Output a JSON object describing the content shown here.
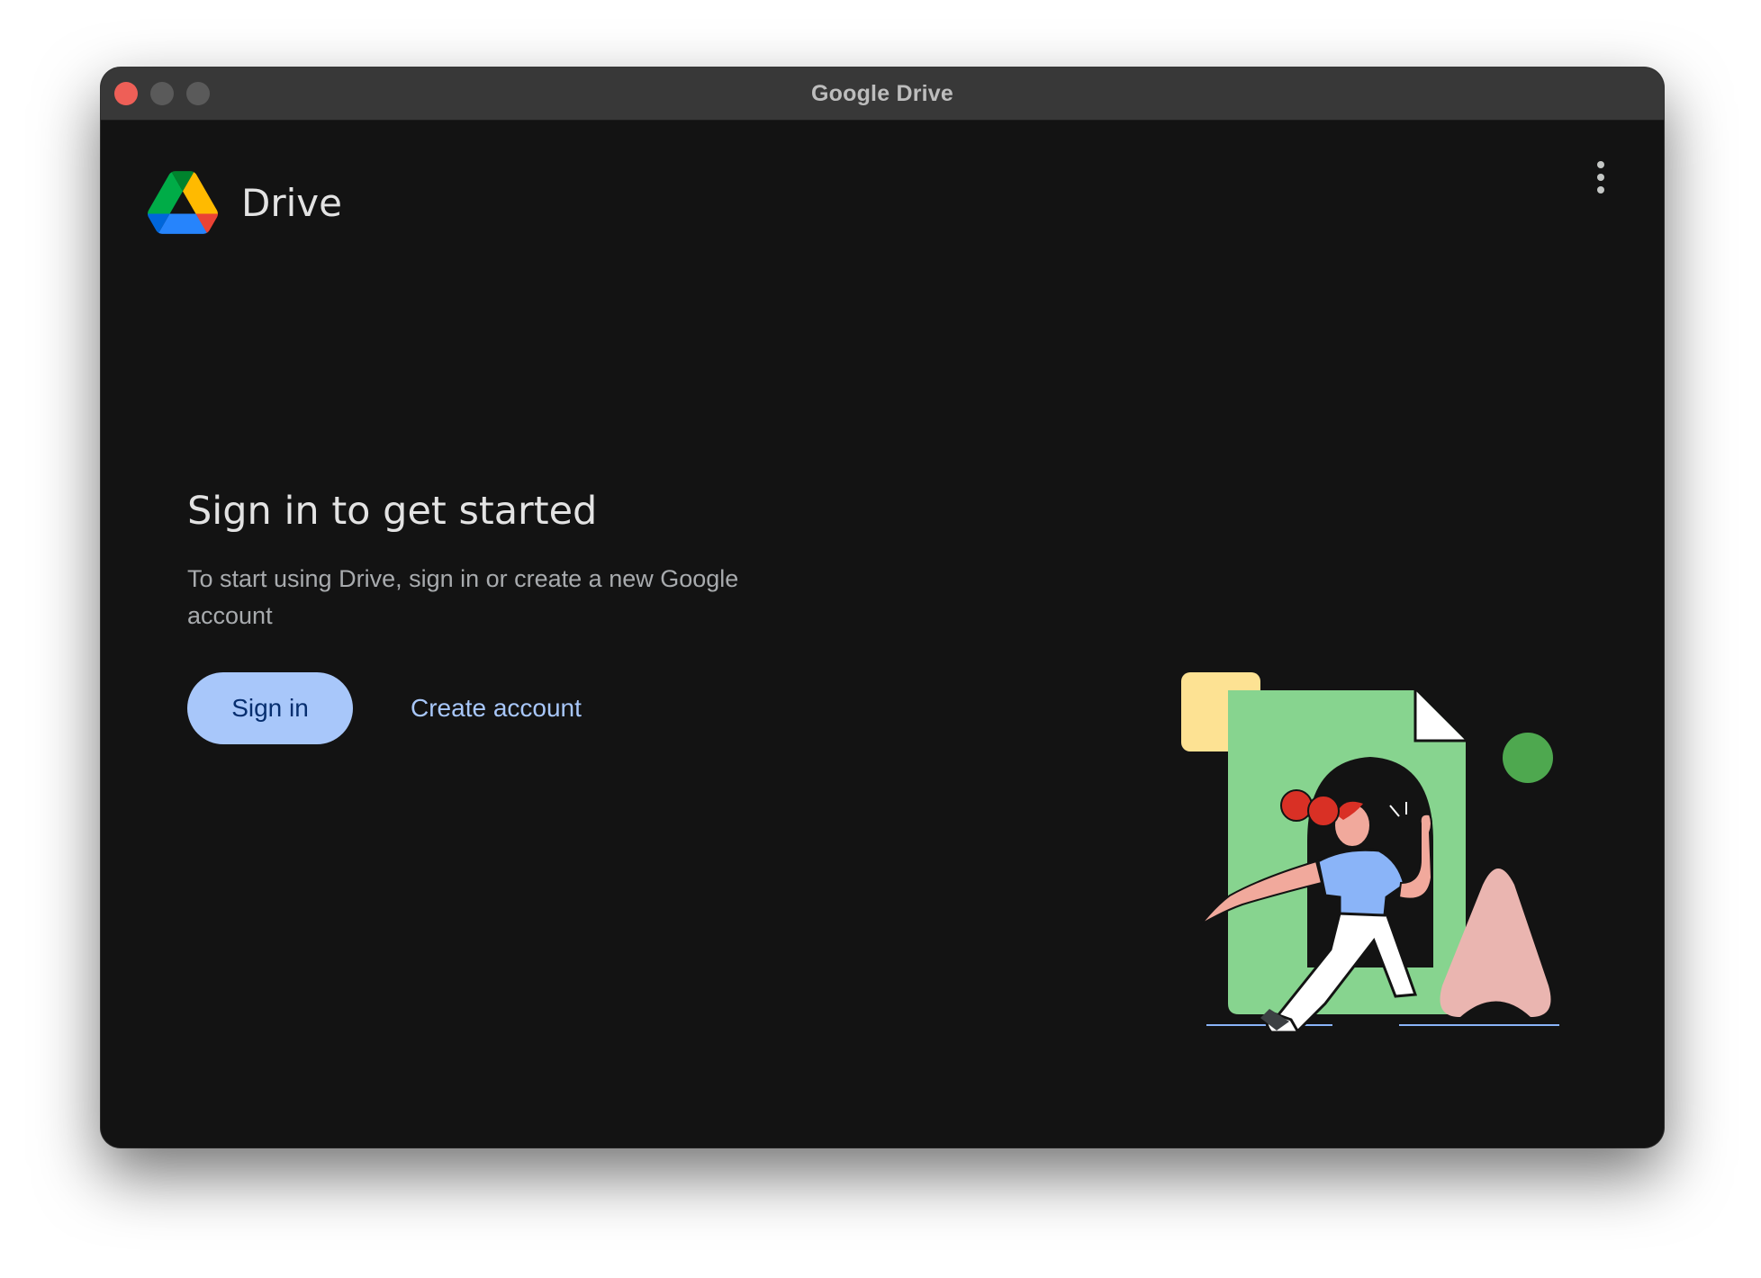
{
  "window": {
    "title": "Google Drive"
  },
  "header": {
    "brand_name": "Drive",
    "logo_icon": "google-drive-logo-icon",
    "menu_icon": "more-vert-icon"
  },
  "main": {
    "heading": "Sign in to get started",
    "description": "To start using Drive, sign in or create a new Google account",
    "sign_in_label": "Sign in",
    "create_account_label": "Create account",
    "illustration": "person-walking-through-document-illustration"
  },
  "colors": {
    "background": "#131313",
    "titlebar": "#383838",
    "primary_button": "#a8c7fa",
    "primary_button_text": "#062e6f",
    "link": "#a8c7fa",
    "close_light": "#ee5f57"
  }
}
